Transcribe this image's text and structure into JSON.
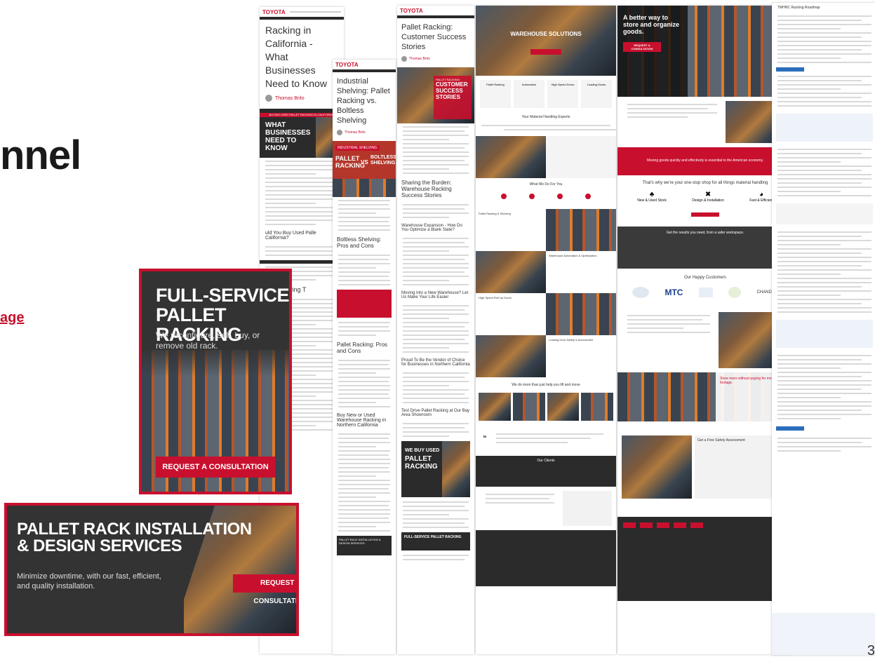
{
  "left_fragment": {
    "word": "nnel",
    "link": "age"
  },
  "page_number": "3",
  "pages": {
    "california": {
      "brand": "TOYOTA",
      "title": "Racking in California - What Businesses Need to Know",
      "author": "Thomas Brito",
      "hero_text": "WHAT BUSINESSES NEED TO KNOW",
      "hero_kicker": "BUYING USED PALLET RACKING IN CALIFORNIA",
      "section_heading": "Rack Buying T",
      "question": "uld You Buy Used Palle California?"
    },
    "industrial": {
      "brand": "TOYOTA",
      "title": "Industrial Shelving: Pallet Racking vs. Boltless Shelving",
      "author": "Thomas Brito",
      "hero_left": "PALLET RACKING",
      "hero_vs": "VS",
      "hero_right": "BOLTLESS SHELVING",
      "hero_kicker": "INDUSTRIAL SHELVING:",
      "h2_a": "Boltless Shelving: Pros and Cons",
      "h2_b": "Pallet Racking: Pros and Cons",
      "h2_c": "Buy New or Used Warehouse Racking in Northern California",
      "bottom_banner": "PALLET RACK INSTALLATION & DESIGN SERVICES"
    },
    "customer": {
      "brand": "TOYOTA",
      "title": "Pallet Racking: Customer Success Stories",
      "author": "Thomas Brito",
      "hero_line1": "PALLET RACKING:",
      "hero_line2": "CUSTOMER SUCCESS STORIES",
      "h2_a": "Sharing the Burden: Warehouse Racking Success Stories",
      "h3_a": "Warehouse Expansion - How Do You Optimize a Blank Slate?",
      "h3_b": "Moving Into a New Warehouse? Let Us Make Your Life Easier",
      "h3_c": "Proud To Be the Vendor of Choice for Businesses in Northern California",
      "h3_d": "Test Drive Pallet Racking at Our Bay Area Showroom",
      "ad1_line1": "WE BUY USED",
      "ad1_line2": "PALLET RACKING",
      "ad2": "FULL-SERVICE PALLET RACKING"
    },
    "solutions": {
      "hero_title": "WAREHOUSE SOLUTIONS",
      "cards": [
        "Pallet Racking",
        "Automation",
        "High Speed Doors",
        "Loading Docks"
      ],
      "section_a": "Your Material Handling Experts",
      "section_b": "What We Do For You",
      "services": [
        "Pallet Racking & Shelving",
        "Warehouse Automation & Optimization",
        "High Speed Roll Up Doors",
        "Loading Dock Safety & Accessories"
      ],
      "section_c": "We do more than just help you lift and move",
      "section_d": "Our Clients"
    },
    "store": {
      "hero_title": "A better way to store and organize goods.",
      "cta": "Request a Consultation",
      "banner": "Moving goods quickly and effectively is essential to the American economy.",
      "heading": "That's why we're your one-stop shop for all things material handling",
      "features": [
        "New & Used Stock",
        "Design & Installation",
        "Fast & Efficient"
      ],
      "quote_heading": "Get the results you need, from a safer workspace.",
      "customers_heading": "Our Happy Customers",
      "customers": [
        "",
        "MTC",
        "",
        "",
        "CHANDON"
      ],
      "bottom_heading": "Store more without paying for more square footage.",
      "form_heading": "Get a Free Safety Assessment"
    },
    "rack_roadmap": {
      "title": "TMHNC Racking Roadmap"
    }
  },
  "ads": {
    "full_service": {
      "title_line1": "FULL-SERVICE",
      "title_line2": "PALLET RACKING",
      "body": "We reconfigure, sell, buy, or remove old rack.",
      "cta": "REQUEST A CONSULTATION"
    },
    "install": {
      "title_line1": "PALLET RACK INSTALLATION",
      "title_line2": "& DESIGN SERVICES",
      "body": "Minimize downtime, with our fast, efficient, and quality installation.",
      "cta": "REQUEST A CONSULTATION"
    }
  },
  "colors": {
    "brand_red": "#c8102e",
    "dark": "#2b2b2b",
    "link_blue": "#2a6ebb"
  }
}
